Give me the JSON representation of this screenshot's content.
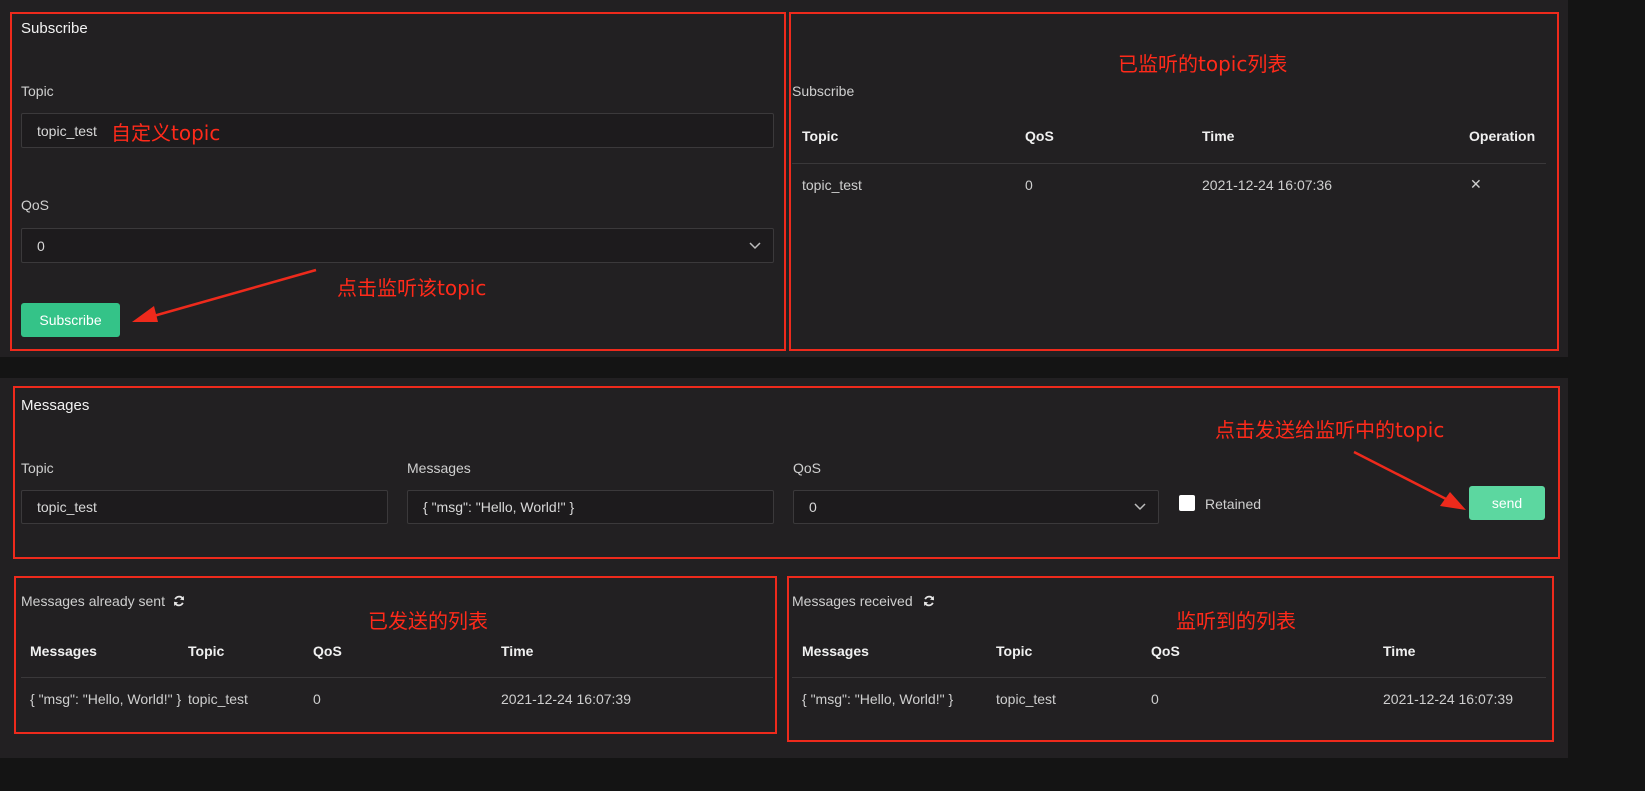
{
  "subscribe_form": {
    "title": "Subscribe",
    "topic_label": "Topic",
    "topic_value": "topic_test",
    "qos_label": "QoS",
    "qos_value": "0",
    "button_label": "Subscribe"
  },
  "subscriptions": {
    "section_label": "Subscribe",
    "columns": [
      "Topic",
      "QoS",
      "Time",
      "Operation"
    ],
    "rows": [
      {
        "topic": "topic_test",
        "qos": "0",
        "time": "2021-12-24 16:07:36",
        "operation": "✕"
      }
    ]
  },
  "publish_form": {
    "title": "Messages",
    "topic_label": "Topic",
    "topic_value": "topic_test",
    "messages_label": "Messages",
    "messages_value": "{ \"msg\": \"Hello, World!\" }",
    "qos_label": "QoS",
    "qos_value": "0",
    "retained_label": "Retained",
    "send_label": "send"
  },
  "sent_messages": {
    "title": "Messages already sent",
    "columns": [
      "Messages",
      "Topic",
      "QoS",
      "Time"
    ],
    "rows": [
      {
        "message": "{ \"msg\": \"Hello, World!\" }",
        "topic": "topic_test",
        "qos": "0",
        "time": "2021-12-24 16:07:39"
      }
    ]
  },
  "received_messages": {
    "title": "Messages received",
    "columns": [
      "Messages",
      "Topic",
      "QoS",
      "Time"
    ],
    "rows": [
      {
        "message": "{ \"msg\": \"Hello, World!\" }",
        "topic": "topic_test",
        "qos": "0",
        "time": "2021-12-24 16:07:39"
      }
    ]
  },
  "annotations": {
    "custom_topic": "自定义topic",
    "click_subscribe": "点击监听该topic",
    "subscribed_list": "已监听的topic列表",
    "click_send": "点击发送给监听中的topic",
    "sent_list": "已发送的列表",
    "received_list": "监听到的列表"
  },
  "icons": {
    "refresh": "refresh-icon",
    "close": "close-icon",
    "chevron": "chevron-down-icon",
    "arrow": "red-arrow"
  },
  "colors": {
    "accent_green": "#34c388",
    "annotation_red": "#ee2a1c",
    "panel_bg": "#222022"
  }
}
